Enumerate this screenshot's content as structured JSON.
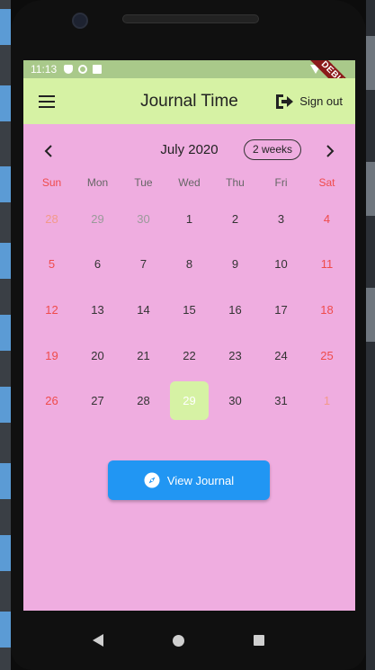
{
  "status_bar": {
    "time": "11:13",
    "debug_label": "DEBUG"
  },
  "app_bar": {
    "title": "Journal Time",
    "signout_label": "Sign out"
  },
  "calendar": {
    "month_title": "July 2020",
    "format_button": "2 weeks",
    "weekdays": [
      "Sun",
      "Mon",
      "Tue",
      "Wed",
      "Thu",
      "Fri",
      "Sat"
    ],
    "weeks": [
      [
        "28",
        "29",
        "30",
        "1",
        "2",
        "3",
        "4"
      ],
      [
        "5",
        "6",
        "7",
        "8",
        "9",
        "10",
        "11"
      ],
      [
        "12",
        "13",
        "14",
        "15",
        "16",
        "17",
        "18"
      ],
      [
        "19",
        "20",
        "21",
        "22",
        "23",
        "24",
        "25"
      ],
      [
        "26",
        "27",
        "28",
        "29",
        "30",
        "31",
        "1"
      ]
    ],
    "selected_day": "29"
  },
  "view_journal_label": "View Journal",
  "colors": {
    "screen_background": "#efade0",
    "app_bar": "#d6f2a4",
    "status_bar": "#a9c98a",
    "weekend_text": "#ef4b4b",
    "selected_day": "#d6f2a4",
    "button": "#2196f3"
  },
  "icons": {
    "menu": "hamburger-menu-icon",
    "signout": "exit-door-icon",
    "prev": "chevron-left-icon",
    "next": "chevron-right-icon",
    "view_journal": "compass-icon"
  }
}
